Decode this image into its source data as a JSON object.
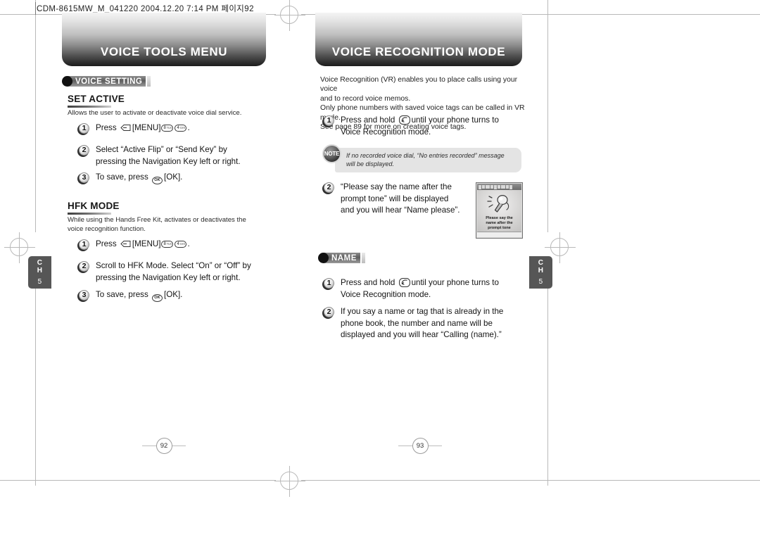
{
  "slug": {
    "text": "CDM-8615MW_M_041220  2004.12.20 7:14 PM  페이지92"
  },
  "left_page": {
    "title": "VOICE TOOLS MENU",
    "badge": "VOICE SETTING",
    "sections": [
      {
        "heading": "SET ACTIVE",
        "description": "Allows the user to activate or deactivate voice dial service.",
        "steps": [
          {
            "num": "1",
            "lines": [
              "Press [MENU] ."
            ],
            "parts": [
              "Press ",
              "[MENU]",
              "."
            ]
          },
          {
            "num": "2",
            "lines": [
              "Select “Active Flip” or “Send Key” by",
              "pressing the Navigation Key left or right."
            ]
          },
          {
            "num": "3",
            "lines": [
              "To save, press [OK]."
            ]
          }
        ]
      },
      {
        "heading": "HFK MODE",
        "description": "While using the Hands Free Kit, activates or deactivates the voice recognition function.",
        "steps": [
          {
            "num": "1",
            "lines": [
              "Press [MENU] ."
            ]
          },
          {
            "num": "2",
            "lines": [
              "Scroll to HFK Mode. Select “On” or “Off” by",
              "pressing the Navigation Key left or right."
            ]
          },
          {
            "num": "3",
            "lines": [
              "To save, press [OK]."
            ]
          }
        ]
      }
    ],
    "step_text": {
      "press_prefix": "Press ",
      "menu_label": "[MENU]",
      "period": ".",
      "save_prefix": "To save, press ",
      "ok_label": "[OK]."
    },
    "keys": {
      "softkey": "left-softkey",
      "key8": "8",
      "key8_sub": "TUV",
      "key4": "4",
      "key4_sub": "GHI",
      "ok": "OK"
    },
    "side_tab": {
      "ch": "C",
      "h": "H",
      "num": "5"
    },
    "folio": "92"
  },
  "right_page": {
    "title": "VOICE RECOGNITION MODE",
    "intro": [
      "Voice Recognition (VR) enables you to place calls using your voice",
      "and to record voice memos.",
      "Only phone numbers with saved voice tags can be called in VR mode.",
      "See page 89 for more on creating voice tags."
    ],
    "steps_top": [
      {
        "num": "1",
        "lines": [
          "Press and hold  until your phone turns to",
          "Voice Recognition mode."
        ],
        "prefix": "Press and hold ",
        "suffix": "until your phone turns to",
        "line2": "Voice Recognition mode."
      },
      {
        "num": "2",
        "lines": [
          "“Please say the name after the",
          "prompt tone” will be displayed",
          "and you will hear “Name please”."
        ]
      }
    ],
    "note": {
      "label": "NOTE",
      "lines": [
        "If no recorded voice dial,  “No entries recorded” message",
        "will be displayed."
      ]
    },
    "phone_screen": {
      "caption_lines": [
        "Please say the",
        "name after the",
        "prompt tone"
      ],
      "icon": "microphone"
    },
    "badge": "NAME",
    "steps_name": [
      {
        "num": "1",
        "prefix": "Press and hold ",
        "suffix": "until your phone turns to",
        "line2": "Voice Recognition mode."
      },
      {
        "num": "2",
        "lines": [
          "If you say a name or tag that is already in the",
          "phone book, the number and name will be",
          "displayed and you will hear “Calling (name).”"
        ]
      }
    ],
    "side_tab": {
      "ch": "C",
      "h": "H",
      "num": "5"
    },
    "folio": "93"
  },
  "colors": {
    "title_bar_dark": "#1c1c1c",
    "badge_plate": "#5e5e5e",
    "note_bg": "#e4e4e4",
    "side_tab": "#565656",
    "rule": "#b9b9b9"
  }
}
